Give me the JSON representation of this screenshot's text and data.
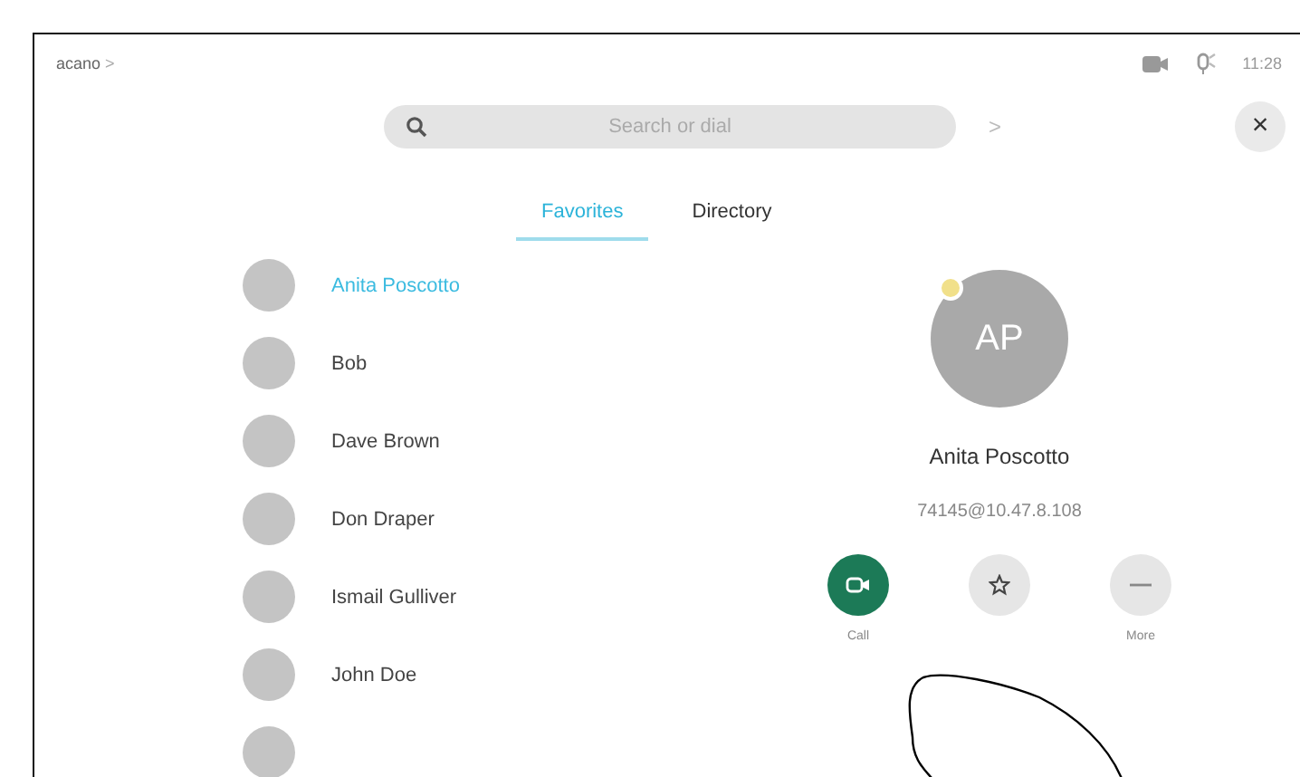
{
  "status_bar": {
    "device": "acano",
    "chevron": ">",
    "time": "11:28"
  },
  "search": {
    "placeholder": "Search or dial",
    "chevron": ">",
    "close": "×"
  },
  "tabs": [
    {
      "label": "Favorites",
      "selected": true
    },
    {
      "label": "Directory",
      "selected": false
    }
  ],
  "contacts": [
    {
      "name": "Anita Poscotto",
      "selected": true
    },
    {
      "name": "Bob",
      "selected": false
    },
    {
      "name": "Dave Brown",
      "selected": false
    },
    {
      "name": "Don Draper",
      "selected": false
    },
    {
      "name": "Ismail Gulliver",
      "selected": false
    },
    {
      "name": "John Doe",
      "selected": false
    }
  ],
  "detail": {
    "initials": "AP",
    "favorite": true,
    "name": "Anita Poscotto",
    "address": "74145@10.47.8.108",
    "actions": [
      {
        "kind": "call",
        "label": "Call"
      },
      {
        "kind": "favorite"
      },
      {
        "kind": "more",
        "label": "More"
      }
    ]
  }
}
